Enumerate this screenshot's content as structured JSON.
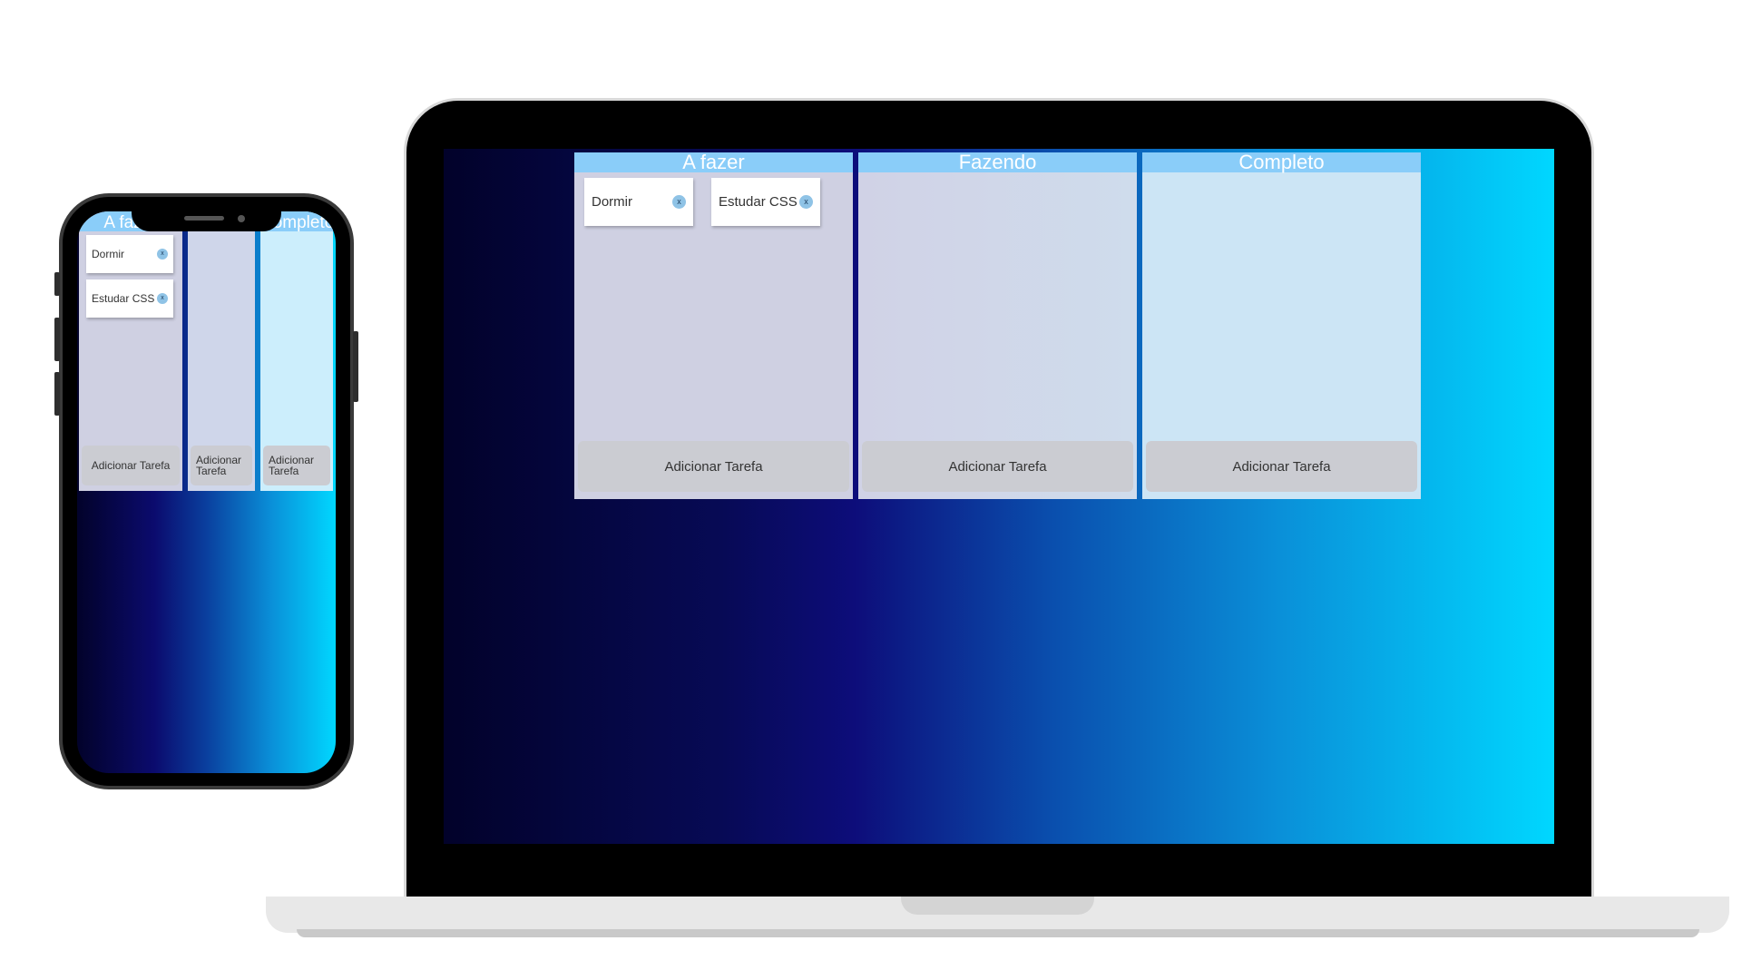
{
  "board": {
    "columns": [
      {
        "title": "A fazer",
        "add_label": "Adicionar Tarefa"
      },
      {
        "title": "Fazendo",
        "add_label": "Adicionar Tarefa"
      },
      {
        "title": "Completo",
        "add_label": "Adicionar Tarefa"
      }
    ],
    "cards": [
      {
        "label": "Dormir",
        "remove_label": "x"
      },
      {
        "label": "Estudar CSS",
        "remove_label": "x"
      }
    ]
  },
  "colors": {
    "header_bg": "#8acdf9",
    "button_bg": "#cbccd2",
    "gradient_start": "#02022a",
    "gradient_end": "#00d7ff"
  }
}
